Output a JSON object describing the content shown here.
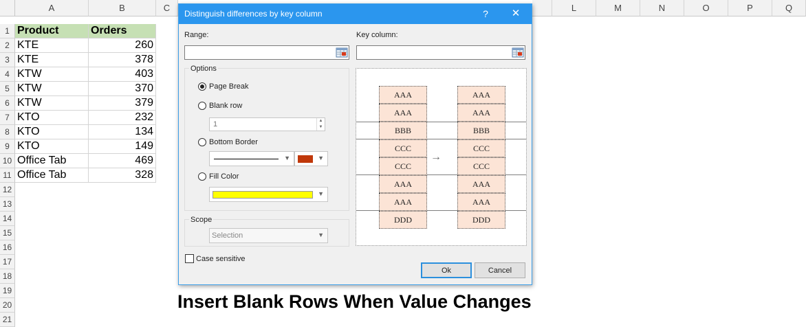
{
  "sheet": {
    "columns": [
      "A",
      "B",
      "C",
      "L",
      "M",
      "N",
      "O",
      "P",
      "Q"
    ],
    "row_numbers": [
      "1",
      "2",
      "3",
      "4",
      "5",
      "6",
      "7",
      "8",
      "9",
      "10",
      "11",
      "12",
      "13",
      "14",
      "15",
      "16",
      "17",
      "18",
      "19",
      "20",
      "21"
    ],
    "header": {
      "product": "Product",
      "orders": "Orders"
    },
    "rows": [
      {
        "product": "KTE",
        "orders": "260"
      },
      {
        "product": "KTE",
        "orders": "378"
      },
      {
        "product": "KTW",
        "orders": "403"
      },
      {
        "product": "KTW",
        "orders": "370"
      },
      {
        "product": "KTW",
        "orders": "379"
      },
      {
        "product": "KTO",
        "orders": "232"
      },
      {
        "product": "KTO",
        "orders": "134"
      },
      {
        "product": "KTO",
        "orders": "149"
      },
      {
        "product": "Office Tab",
        "orders": "469"
      },
      {
        "product": "Office Tab",
        "orders": "328"
      }
    ],
    "header_fill": "#c6e0b4"
  },
  "dialog": {
    "title": "Distinguish differences by key column",
    "help": "?",
    "close": "✕",
    "range_label": "Range:",
    "range_value": "",
    "key_column_label": "Key column:",
    "key_column_value": "",
    "options_label": "Options",
    "options": {
      "page_break": {
        "label": "Page Break",
        "selected": true
      },
      "blank_row": {
        "label": "Blank row",
        "selected": false,
        "value": "1"
      },
      "bottom_border": {
        "label": "Bottom Border",
        "selected": false,
        "border_color": "#c0380a"
      },
      "fill_color": {
        "label": "Fill Color",
        "selected": false,
        "color": "#ffff00"
      }
    },
    "scope_label": "Scope",
    "scope_value": "Selection",
    "case_sensitive_label": "Case sensitive",
    "case_sensitive_checked": false,
    "ok_label": "Ok",
    "cancel_label": "Cancel",
    "accent_color": "#2b96ee",
    "preview": {
      "left": [
        "AAA",
        "AAA",
        "BBB",
        "CCC",
        "CCC",
        "AAA",
        "AAA",
        "DDD"
      ],
      "right": [
        "AAA",
        "AAA",
        "BBB",
        "CCC",
        "CCC",
        "AAA",
        "AAA",
        "DDD"
      ],
      "arrow": "→",
      "cell_fill": "#fce4d6"
    }
  },
  "caption": "Insert Blank Rows When Value Changes"
}
